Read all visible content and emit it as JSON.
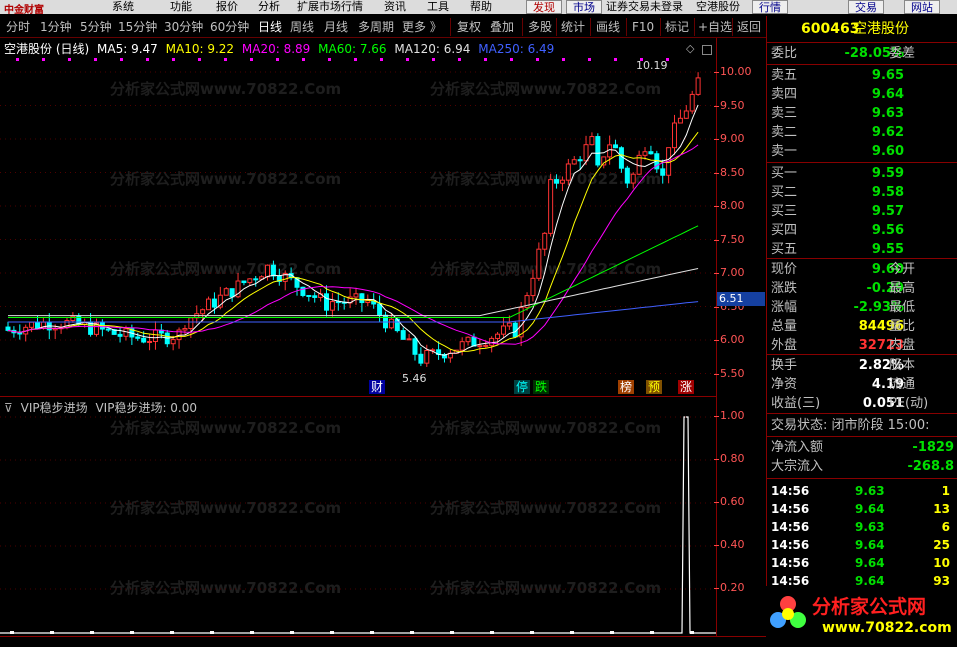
{
  "menubar": {
    "logo_text": "中金财富",
    "items": [
      "系统",
      "功能",
      "报价",
      "分析",
      "扩展市场行情",
      "资讯",
      "工具",
      "帮助"
    ],
    "buttons": [
      "发现",
      "市场",
      "证券交易未登录",
      "空港股份",
      "行情",
      "交易",
      "网站"
    ]
  },
  "toolbar": {
    "periods": [
      "分时",
      "1分钟",
      "5分钟",
      "15分钟",
      "30分钟",
      "60分钟",
      "日线",
      "周线",
      "月线",
      "多周期",
      "更多 》"
    ],
    "active_period": "日线",
    "functions": [
      "复权",
      "叠加",
      "多股",
      "统计",
      "画线",
      "F10",
      "标记",
      "+自选",
      "返回"
    ]
  },
  "main_chart": {
    "title": "空港股份 (日线)",
    "ma": [
      {
        "label": "MA5: 9.47",
        "color": "#ffffff"
      },
      {
        "label": "MA10: 9.22",
        "color": "#ffff00"
      },
      {
        "label": "MA20: 8.89",
        "color": "#ff00ff"
      },
      {
        "label": "MA60: 7.66",
        "color": "#00ff00"
      },
      {
        "label": "MA120: 6.94",
        "color": "#e0e0e0"
      },
      {
        "label": "MA250: 6.49",
        "color": "#4060ff"
      }
    ],
    "high_label": "10.19",
    "low_label": "5.46",
    "current_price_tag": "6.51",
    "price_scale": [
      "10.00",
      "9.50",
      "9.00",
      "8.50",
      "8.00",
      "7.50",
      "7.00",
      "6.50",
      "6.00",
      "5.50"
    ],
    "markers": [
      {
        "text": "财",
        "color": "#ffffff",
        "bg": "#0000a0"
      },
      {
        "text": "停",
        "color": "#00ffff",
        "bg": "#004040"
      },
      {
        "text": "跌",
        "color": "#00ff00",
        "bg": "#003000"
      },
      {
        "text": "榜",
        "color": "#ffffff",
        "bg": "#a04000"
      },
      {
        "text": "预",
        "color": "#ffff00",
        "bg": "#805000"
      },
      {
        "text": "涨",
        "color": "#ffffff",
        "bg": "#a00000"
      }
    ]
  },
  "indicator": {
    "name": "VIP稳步进场",
    "value_label": "VIP稳步进场: 0.00",
    "scale": [
      "1.00",
      "0.80",
      "0.60",
      "0.40",
      "0.20"
    ]
  },
  "watermark": "分析家公式网www.70822.Com",
  "quote": {
    "code": "600463",
    "name": "空港股份",
    "weibi_label": "委比",
    "weibi_value": "-28.05%",
    "weicha_label": "委差",
    "sell": [
      {
        "label": "卖五",
        "price": "9.65"
      },
      {
        "label": "卖四",
        "price": "9.64"
      },
      {
        "label": "卖三",
        "price": "9.63"
      },
      {
        "label": "卖二",
        "price": "9.62"
      },
      {
        "label": "卖一",
        "price": "9.60"
      }
    ],
    "buy": [
      {
        "label": "买一",
        "price": "9.59"
      },
      {
        "label": "买二",
        "price": "9.58"
      },
      {
        "label": "买三",
        "price": "9.57"
      },
      {
        "label": "买四",
        "price": "9.56"
      },
      {
        "label": "买五",
        "price": "9.55"
      }
    ],
    "stats": [
      {
        "label": "现价",
        "value": "9.60",
        "color": "green",
        "label2": "今开"
      },
      {
        "label": "涨跌",
        "value": "-0.29",
        "color": "green",
        "label2": "最高"
      },
      {
        "label": "涨幅",
        "value": "-2.93%",
        "color": "green",
        "label2": "最低"
      },
      {
        "label": "总量",
        "value": "84496",
        "color": "yellow",
        "label2": "量比"
      },
      {
        "label": "外盘",
        "value": "32723",
        "color": "red",
        "label2": "内盘"
      }
    ],
    "stats2": [
      {
        "label": "换手",
        "value": "2.82%",
        "color": "white",
        "label2": "股本"
      },
      {
        "label": "净资",
        "value": "4.19",
        "color": "white",
        "label2": "流通"
      },
      {
        "label": "收益(三)",
        "value": "0.051",
        "color": "white",
        "label2": "PE(动)"
      }
    ],
    "trade_status": "交易状态: 闭市阶段 15:00:",
    "net_inflow_label": "净流入额",
    "net_inflow_value": "-1829",
    "block_inflow_label": "大宗流入",
    "block_inflow_value": "-268.8",
    "ticks": [
      {
        "time": "14:56",
        "price": "9.63",
        "vol": "1"
      },
      {
        "time": "14:56",
        "price": "9.64",
        "vol": "13"
      },
      {
        "time": "14:56",
        "price": "9.63",
        "vol": "6"
      },
      {
        "time": "14:56",
        "price": "9.64",
        "vol": "25"
      },
      {
        "time": "14:56",
        "price": "9.64",
        "vol": "10"
      },
      {
        "time": "14:56",
        "price": "9.64",
        "vol": "93"
      }
    ]
  },
  "brand": {
    "name": "分析家公式网",
    "url": "www.70822.com"
  },
  "colors": {
    "up": "#ff3333",
    "down": "#00ffff",
    "grid": "#800000",
    "background": "#000000"
  }
}
